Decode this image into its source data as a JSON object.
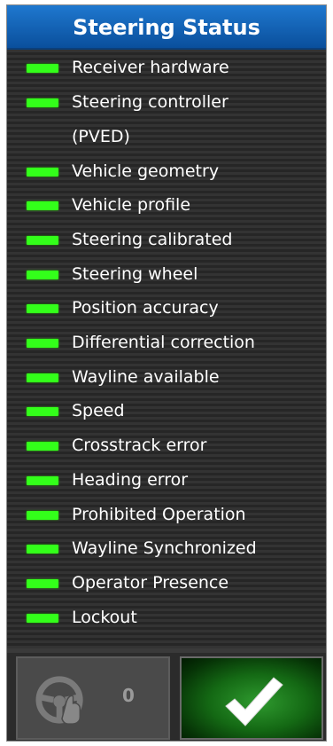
{
  "panel": {
    "title": "Steering Status"
  },
  "items": [
    {
      "label": "Receiver hardware"
    },
    {
      "label": "Steering controller"
    },
    {
      "label": "(PVED)"
    },
    {
      "label": "Vehicle geometry"
    },
    {
      "label": "Vehicle profile"
    },
    {
      "label": "Steering calibrated"
    },
    {
      "label": "Steering wheel"
    },
    {
      "label": "Position accuracy"
    },
    {
      "label": "Differential correction"
    },
    {
      "label": "Wayline available"
    },
    {
      "label": "Speed"
    },
    {
      "label": "Crosstrack error"
    },
    {
      "label": "Heading error"
    },
    {
      "label": "Prohibited Operation"
    },
    {
      "label": "Wayline Synchronized"
    },
    {
      "label": "Operator Presence"
    },
    {
      "label": "Lockout"
    }
  ],
  "footer": {
    "engage_count": "0",
    "engage_icon": "steering-wheel-icon",
    "ok_icon": "checkmark-icon"
  },
  "colors": {
    "title_bar": "#1565c0",
    "status_ok": "#33ff1a",
    "ok_button": "#1e7d1e"
  }
}
